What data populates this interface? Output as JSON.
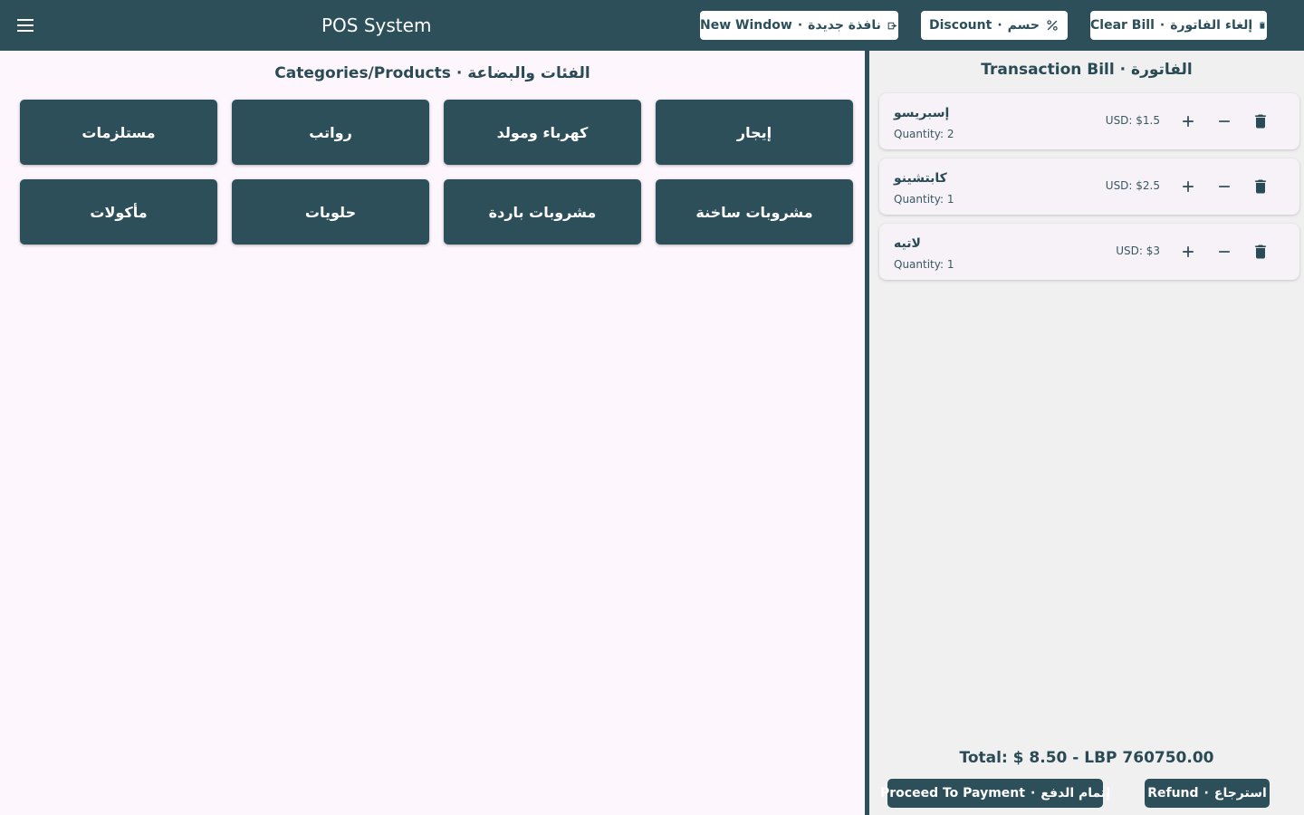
{
  "header": {
    "title": "POS System",
    "new_window": {
      "en": "New Window",
      "ar": "نافذة جديدة"
    },
    "discount": {
      "en": "Discount",
      "ar": "حسم"
    },
    "clear_bill": {
      "en": "Clear Bill",
      "ar": "إلغاء الفاتورة"
    },
    "separator": "·"
  },
  "categories": {
    "title_en": "Categories/Products",
    "title_ar": "الفئات والبضاعة",
    "items": [
      "إيجار",
      "كهرباء ومولد",
      "رواتب",
      "مستلزمات",
      "مشروبات ساخنة",
      "مشروبات باردة",
      "حلويات",
      "مأكولات"
    ]
  },
  "bill": {
    "title_en": "Transaction Bill",
    "title_ar": "الفاتورة",
    "items": [
      {
        "name": "إسبريسو",
        "quantity": "Quantity: 2",
        "price": "USD: $1.5"
      },
      {
        "name": "كابتشينو",
        "quantity": "Quantity: 1",
        "price": "USD: $2.5"
      },
      {
        "name": "لاتيه",
        "quantity": "Quantity: 1",
        "price": "USD: $3"
      }
    ],
    "total": "Total: $ 8.50 - LBP 760750.00",
    "proceed": {
      "en": "Proceed To Payment",
      "ar": "إتمام الدفع"
    },
    "refund": {
      "en": "Refund",
      "ar": "استرجاع"
    }
  },
  "icons": {
    "menu": "menu-icon",
    "new_window": "open-window-icon",
    "discount": "percent-icon",
    "clear_bill": "trash-icon",
    "increase": "plus-icon",
    "decrease": "minus-icon",
    "remove": "trash-icon"
  },
  "colors": {
    "primary": "#2c4f5a",
    "background": "#fdf7fd",
    "bill_background": "#f0f0f0"
  }
}
